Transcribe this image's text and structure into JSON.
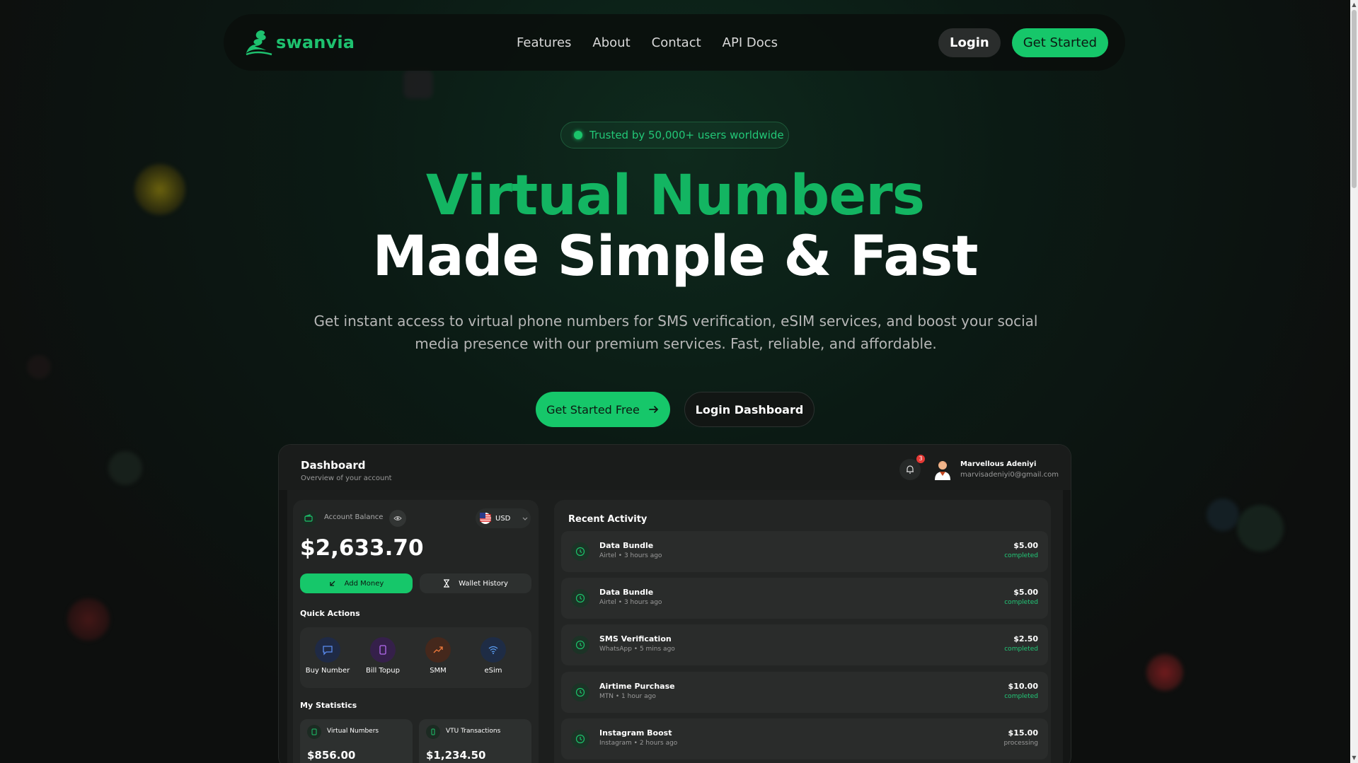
{
  "nav": {
    "logo_text": "swanvia",
    "links": [
      "Features",
      "About",
      "Contact",
      "API Docs"
    ],
    "login_label": "Login",
    "get_started_label": "Get Started"
  },
  "hero": {
    "badge": "Trusted by 50,000+ users worldwide",
    "title_line1": "Virtual Numbers",
    "title_line2": "Made Simple & Fast",
    "subtitle": "Get instant access to virtual phone numbers for SMS verification, eSIM services, and boost your social media presence with our premium services. Fast, reliable, and affordable.",
    "cta_primary": "Get Started Free",
    "cta_secondary": "Login Dashboard"
  },
  "dashboard": {
    "title": "Dashboard",
    "subtitle": "Overview of your account",
    "notification_count": "3",
    "user_name": "Marvellous Adeniyi",
    "user_email": "marvisadeniyi0@gmail.com",
    "balance_label": "Account Balance",
    "currency": "USD",
    "balance": "$2,633.70",
    "add_money": "Add Money",
    "wallet_history": "Wallet History",
    "quick_actions_title": "Quick Actions",
    "quick_actions": [
      {
        "label": "Buy Number",
        "icon": "chat-icon",
        "color": "#3b6fe0"
      },
      {
        "label": "Bill Topup",
        "icon": "phone-icon",
        "color": "#a54be0"
      },
      {
        "label": "SMM",
        "icon": "trend-up-icon",
        "color": "#e0703b"
      },
      {
        "label": "eSim",
        "icon": "wifi-icon",
        "color": "#3b8be0"
      }
    ],
    "statistics_title": "My Statistics",
    "statistics": [
      {
        "label": "Virtual Numbers",
        "value": "$856.00"
      },
      {
        "label": "VTU Transactions",
        "value": "$1,234.50"
      }
    ],
    "recent_activity_title": "Recent Activity",
    "activities": [
      {
        "name": "Data Bundle",
        "sub": "Airtel • 3 hours ago",
        "amount": "$5.00",
        "status": "completed"
      },
      {
        "name": "Data Bundle",
        "sub": "Airtel • 3 hours ago",
        "amount": "$5.00",
        "status": "completed"
      },
      {
        "name": "SMS Verification",
        "sub": "WhatsApp • 5 mins ago",
        "amount": "$2.50",
        "status": "completed"
      },
      {
        "name": "Airtime Purchase",
        "sub": "MTN • 1 hour ago",
        "amount": "$10.00",
        "status": "completed"
      },
      {
        "name": "Instagram Boost",
        "sub": "Instagram • 2 hours ago",
        "amount": "$15.00",
        "status": "processing"
      }
    ]
  },
  "colors": {
    "accent": "#16c76a",
    "completed": "#22c777",
    "processing": "#9a9a9a"
  }
}
